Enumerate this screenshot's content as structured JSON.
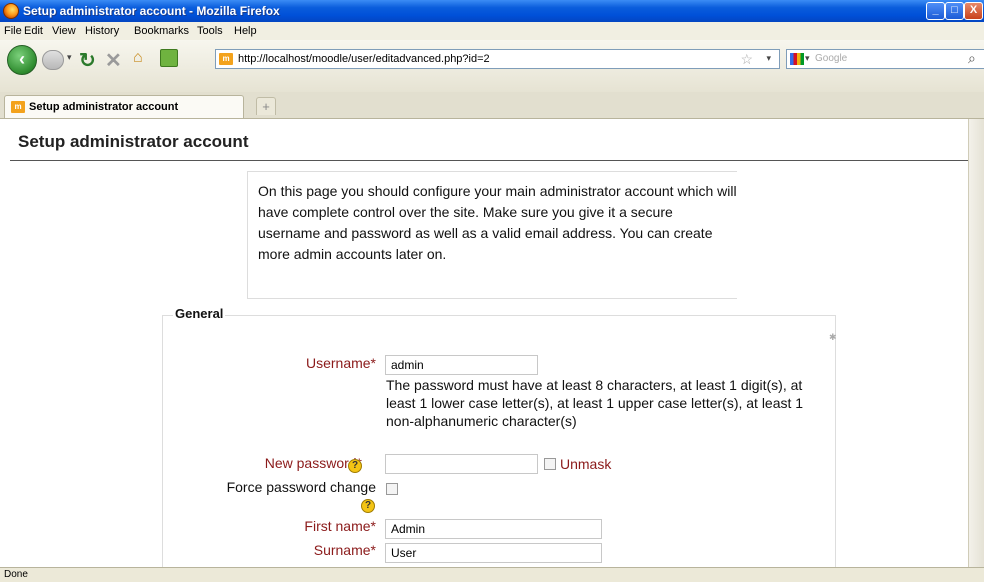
{
  "window": {
    "title": "Setup administrator account - Mozilla Firefox",
    "minimize_glyph": "_",
    "maximize_glyph": "□",
    "close_glyph": "X"
  },
  "menu": [
    "File",
    "Edit",
    "View",
    "History",
    "Bookmarks",
    "Tools",
    "Help"
  ],
  "toolbar": {
    "url": "http://localhost/moodle/user/editadvanced.php?id=2",
    "search_placeholder": "Google",
    "site_icon_text": "m"
  },
  "tabs": [
    {
      "label": "Setup administrator account"
    }
  ],
  "new_tab_glyph": "+",
  "page": {
    "title": "Setup administrator account",
    "intro": "On this page you should configure your main administrator account which will have complete control over the site. Make sure you give it a secure username and password as well as a valid email address. You can create more admin accounts later on."
  },
  "form": {
    "legend": "General",
    "username_label": "Username*",
    "username_value": "admin",
    "password_note": "The password must have at least 8 characters, at least 1 digit(s), at least 1 lower case letter(s), at least 1 upper case letter(s), at least 1 non-alphanumeric character(s)",
    "new_password_label": "New password*",
    "new_password_value": "",
    "unmask_label": "Unmask",
    "force_change_label": "Force password change",
    "first_name_label": "First name*",
    "first_name_value": "Admin",
    "surname_label": "Surname*",
    "surname_value": "User",
    "help_glyph": "?"
  },
  "status": {
    "text": "Done"
  },
  "colors": {
    "required_label": "#8b1a1a",
    "titlebar": "#0a5ddc",
    "help_icon": "#f3c414"
  },
  "icons": [
    "firefox-logo-icon",
    "back-icon",
    "forward-icon",
    "reload-icon",
    "stop-icon",
    "home-icon",
    "bookmark-add-icon",
    "star-icon",
    "google-icon",
    "search-icon",
    "help-icon"
  ]
}
